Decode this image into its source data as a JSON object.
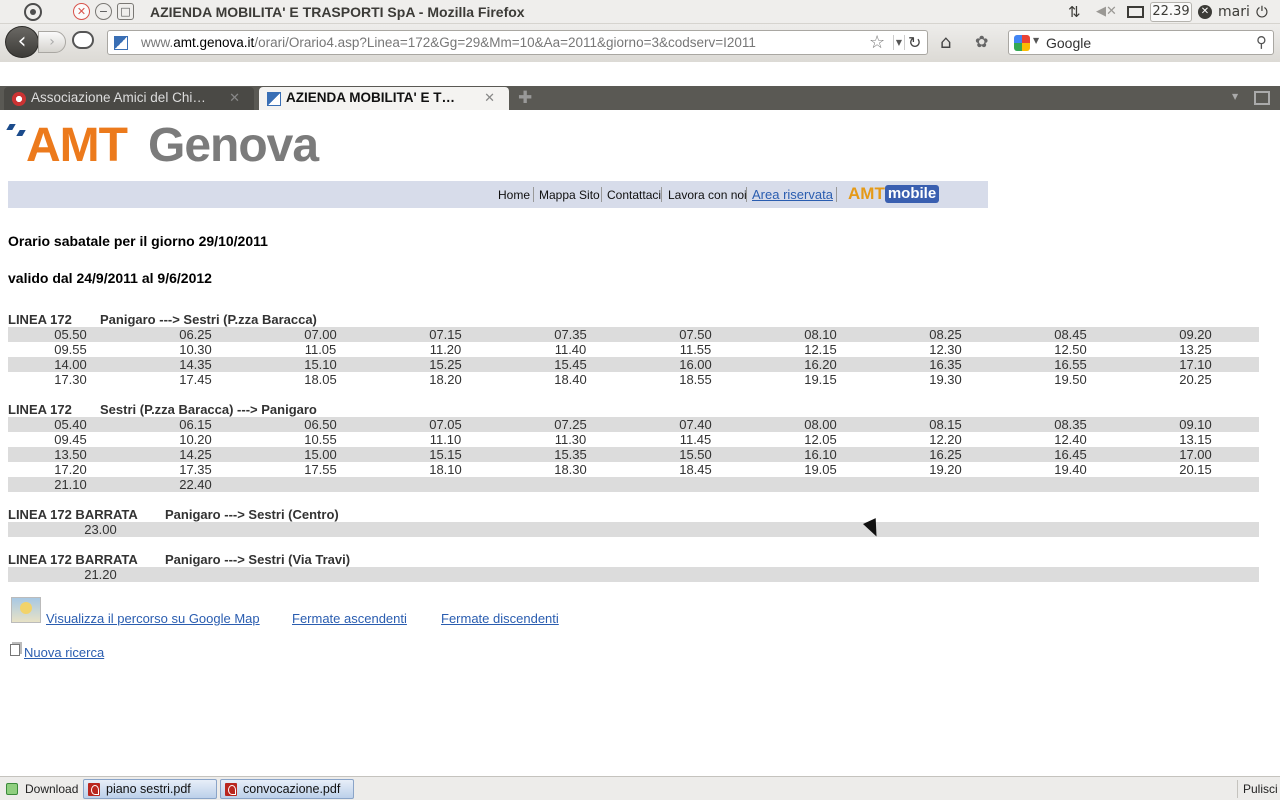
{
  "window": {
    "title": "AZIENDA MOBILITA' E TRASPORTI SpA - Mozilla Firefox"
  },
  "tray": {
    "clock": "22.39",
    "user": "mari"
  },
  "navbar": {
    "url_pre": "www.",
    "url_host": "amt.genova.it",
    "url_path": "/orari/Orario4.asp?Linea=172&Gg=29&Mm=10&Aa=2011&giorno=3&codserv=I2011",
    "search_engine": "Google"
  },
  "tabs": [
    {
      "label": "Associazione Amici del Chi…",
      "active": false
    },
    {
      "label": "AZIENDA MOBILITA' E T…",
      "active": true
    }
  ],
  "site": {
    "logo_amt": "AMT",
    "logo_genova": "Genova",
    "nav": {
      "home": "Home",
      "mappa": "Mappa Sito",
      "contattaci": "Contattaci",
      "lavora": "Lavora con noi",
      "area": "Area riservata"
    },
    "amtmobile_amt": "AMT",
    "amtmobile_mobile": "mobile"
  },
  "schedule": {
    "heading": "Orario sabatale per il giorno 29/10/2011",
    "validity": "valido dal 24/9/2011 al 9/6/2012",
    "sections": [
      {
        "line": "LINEA 172",
        "direction": "Panigaro ---> Sestri (P.zza Baracca)",
        "rows": [
          [
            "05.50",
            "06.25",
            "07.00",
            "07.15",
            "07.35",
            "07.50",
            "08.10",
            "08.25",
            "08.45",
            "09.20"
          ],
          [
            "09.55",
            "10.30",
            "11.05",
            "11.20",
            "11.40",
            "11.55",
            "12.15",
            "12.30",
            "12.50",
            "13.25"
          ],
          [
            "14.00",
            "14.35",
            "15.10",
            "15.25",
            "15.45",
            "16.00",
            "16.20",
            "16.35",
            "16.55",
            "17.10"
          ],
          [
            "17.30",
            "17.45",
            "18.05",
            "18.20",
            "18.40",
            "18.55",
            "19.15",
            "19.30",
            "19.50",
            "20.25"
          ]
        ]
      },
      {
        "line": "LINEA 172",
        "direction": "Sestri (P.zza Baracca) ---> Panigaro",
        "rows": [
          [
            "05.40",
            "06.15",
            "06.50",
            "07.05",
            "07.25",
            "07.40",
            "08.00",
            "08.15",
            "08.35",
            "09.10"
          ],
          [
            "09.45",
            "10.20",
            "10.55",
            "11.10",
            "11.30",
            "11.45",
            "12.05",
            "12.20",
            "12.40",
            "13.15"
          ],
          [
            "13.50",
            "14.25",
            "15.00",
            "15.15",
            "15.35",
            "15.50",
            "16.10",
            "16.25",
            "16.45",
            "17.00"
          ],
          [
            "17.20",
            "17.35",
            "17.55",
            "18.10",
            "18.30",
            "18.45",
            "19.05",
            "19.20",
            "19.40",
            "20.15"
          ],
          [
            "21.10",
            "22.40"
          ]
        ]
      },
      {
        "line": "LINEA 172 BARRATA",
        "direction": "Panigaro ---> Sestri (Centro)",
        "rows": [
          [
            "23.00"
          ]
        ]
      },
      {
        "line": "LINEA 172 BARRATA",
        "direction": "Panigaro ---> Sestri (Via Travi)",
        "rows": [
          [
            "21.20"
          ]
        ]
      }
    ]
  },
  "links": {
    "map": "Visualizza il percorso su Google Map",
    "asc": "Fermate ascendenti",
    "desc": "Fermate discendenti",
    "new_search": "Nuova ricerca"
  },
  "downloads": {
    "toggle_label": "Download",
    "items": [
      "piano sestri.pdf",
      "convocazione.pdf"
    ],
    "clear_label": "Pulisci"
  },
  "colors": {
    "amt_orange": "#ec7a1c",
    "genova_gray": "#7b7b7b",
    "nav_strip": "#d7dcea",
    "row_shade": "#dcdcdc",
    "link": "#2a5db0"
  }
}
